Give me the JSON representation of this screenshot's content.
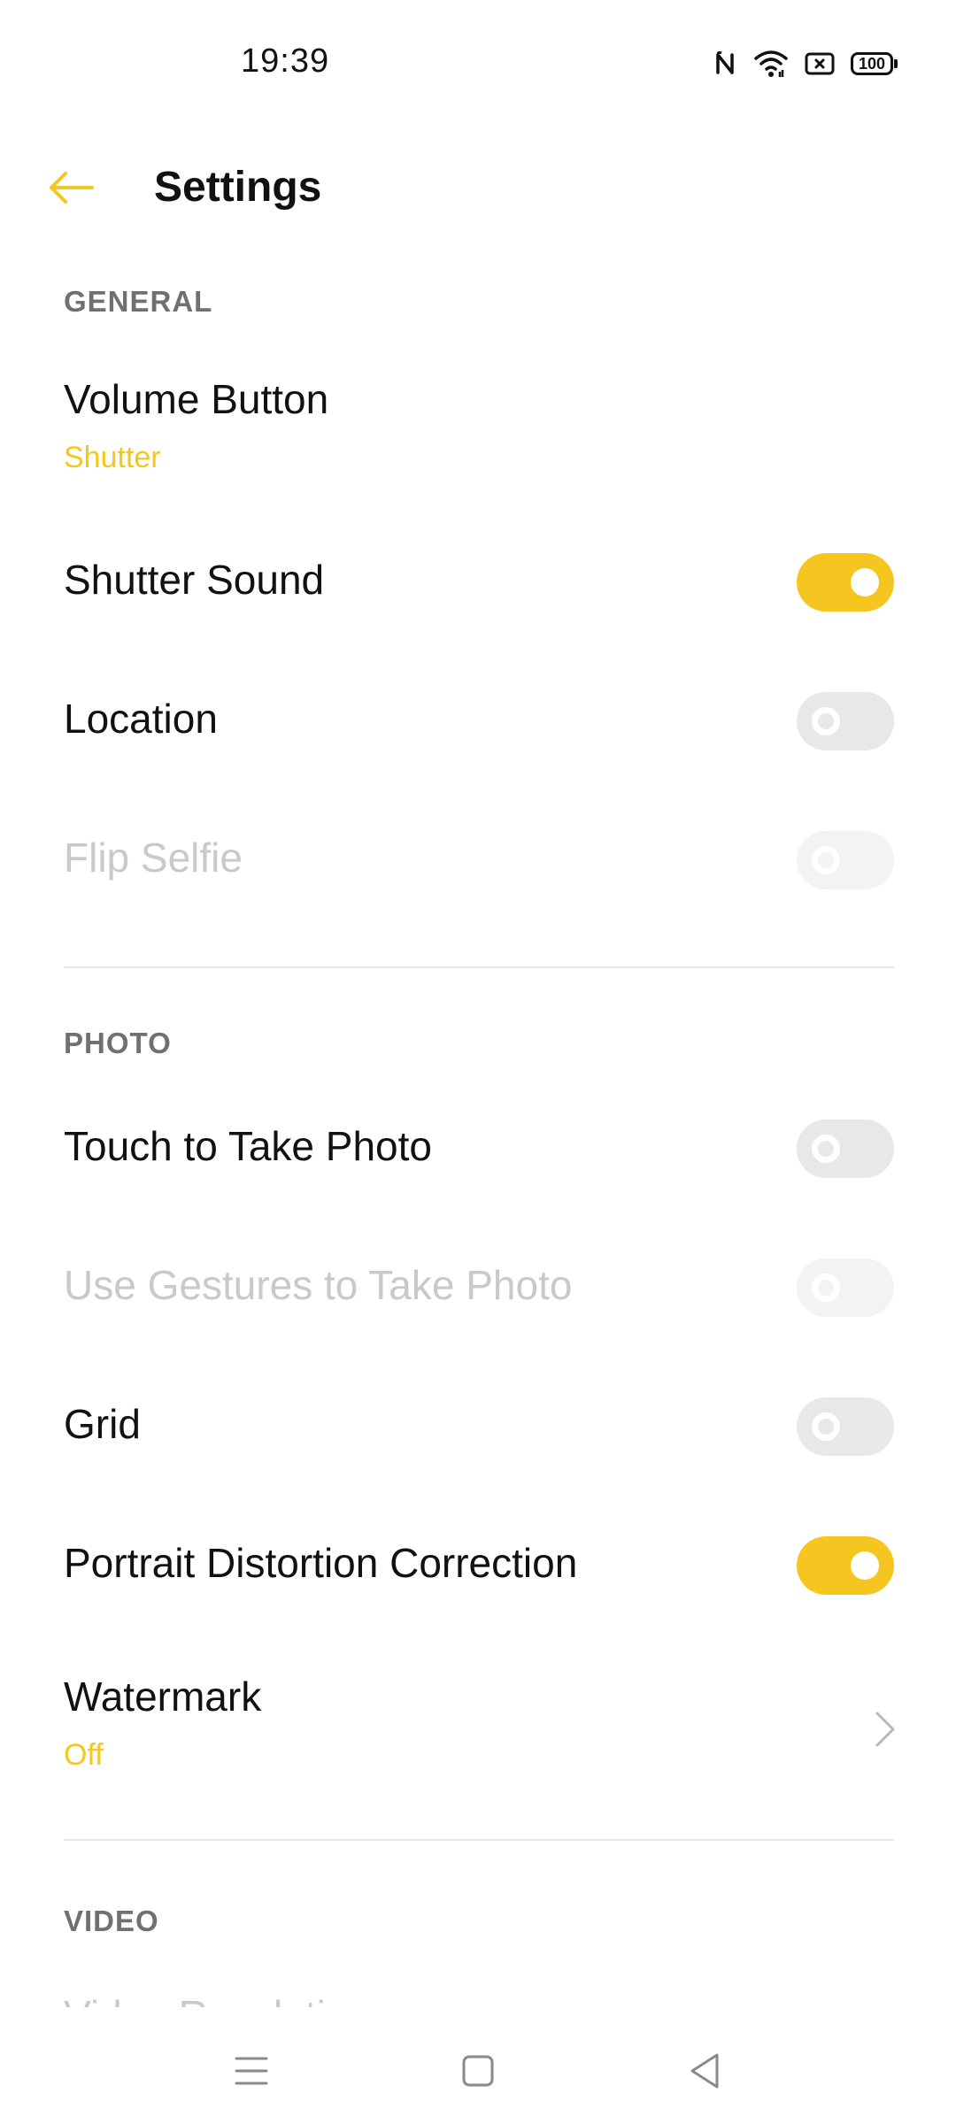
{
  "status_bar": {
    "time": "19:39",
    "battery": "100",
    "icons": [
      "nfc-icon",
      "wifi-icon",
      "sim-error-icon",
      "battery-icon"
    ]
  },
  "header": {
    "title": "Settings",
    "back_icon": "arrow-left-icon"
  },
  "colors": {
    "accent": "#f6c620",
    "accent_text": "#f3c81c",
    "section_header": "#707070",
    "disabled_text": "#c9c9c9",
    "toggle_off": "#e8e8e8"
  },
  "sections": {
    "general": {
      "header": "GENERAL",
      "volume_button": {
        "title": "Volume Button",
        "value": "Shutter"
      },
      "shutter_sound": {
        "title": "Shutter Sound",
        "state": "on"
      },
      "location": {
        "title": "Location",
        "state": "off"
      },
      "flip_selfie": {
        "title": "Flip Selfie",
        "state": "off",
        "enabled": false
      }
    },
    "photo": {
      "header": "PHOTO",
      "touch_to_take_photo": {
        "title": "Touch to Take Photo",
        "state": "off"
      },
      "use_gestures": {
        "title": "Use Gestures to Take Photo",
        "state": "off",
        "enabled": false
      },
      "grid": {
        "title": "Grid",
        "state": "off"
      },
      "portrait_distortion": {
        "title": "Portrait Distortion Correction",
        "state": "on"
      },
      "watermark": {
        "title": "Watermark",
        "value": "Off"
      }
    },
    "video": {
      "header": "VIDEO",
      "video_resolution": {
        "title": "Video Resolution"
      }
    }
  },
  "nav_bar": {
    "buttons": [
      "menu-icon",
      "home-icon",
      "back-triangle-icon"
    ]
  }
}
